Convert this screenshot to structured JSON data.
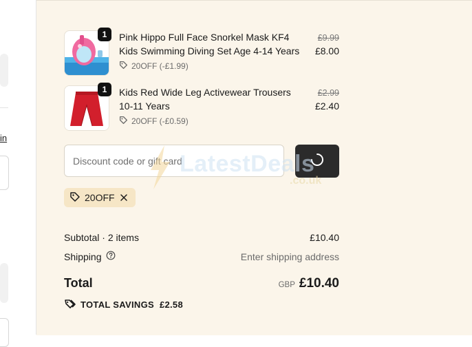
{
  "left": {
    "link_fragment": "in"
  },
  "items": [
    {
      "title": "Pink Hippo Full Face Snorkel Mask KF4 Kids Swimming Diving Set Age 4-14 Years",
      "quantity": "1",
      "discount": "20OFF (-£1.99)",
      "original_price": "£9.99",
      "price": "£8.00",
      "thumbnail_icon": "snorkel-mask-image"
    },
    {
      "title": "Kids Red Wide Leg Activewear Trousers 10-11 Years",
      "quantity": "1",
      "discount": "20OFF (-£0.59)",
      "original_price": "£2.99",
      "price": "£2.40",
      "thumbnail_icon": "red-trousers-image"
    }
  ],
  "discount": {
    "placeholder": "Discount code or gift card",
    "value": "",
    "apply_button_state": "loading",
    "applied_code": "20OFF"
  },
  "watermark": {
    "text": "LatestDeals",
    "sub": ".co.uk"
  },
  "summary": {
    "subtotal_label": "Subtotal · 2 items",
    "subtotal_value": "£10.40",
    "shipping_label": "Shipping",
    "shipping_value": "Enter shipping address",
    "total_label": "Total",
    "currency": "GBP",
    "total_value": "£10.40",
    "savings_label": "TOTAL SAVINGS",
    "savings_value": "£2.58"
  },
  "colors": {
    "summary_bg": "#fbf5ea",
    "chip_bg": "#f6e6c6",
    "button_bg": "#2b2b2b",
    "badge_bg": "#111111"
  }
}
